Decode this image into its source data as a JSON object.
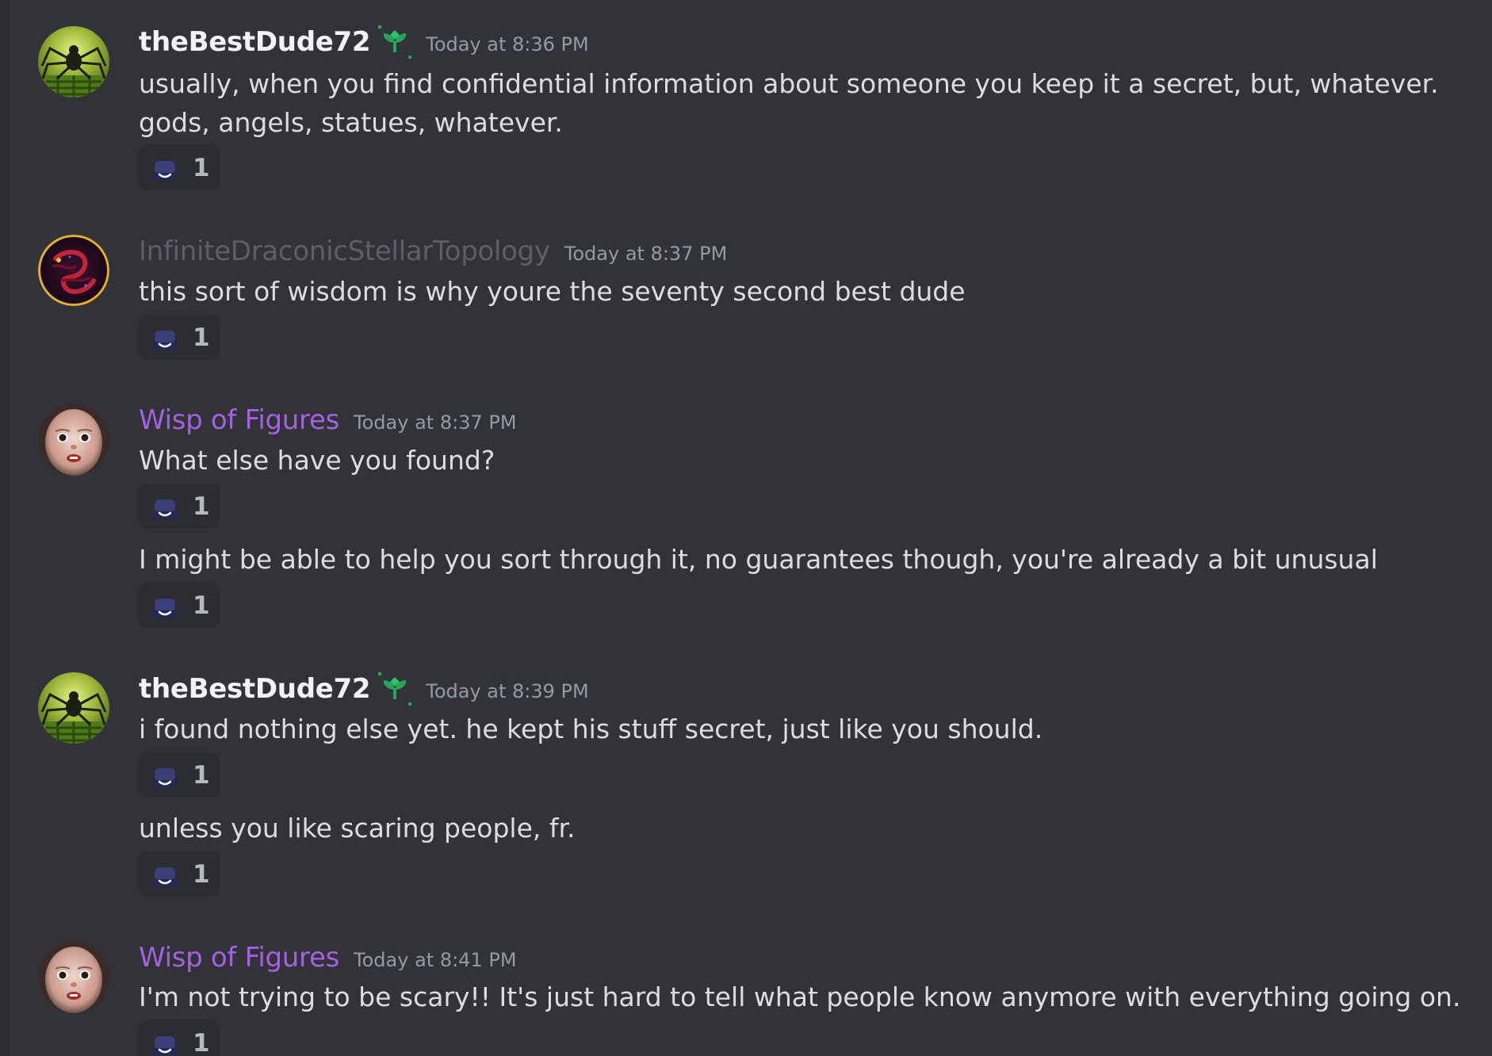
{
  "colors": {
    "background": "#313338",
    "username_default": "#f2f3f5",
    "username_violet": "#a561e0",
    "username_faded": "#5c5f66",
    "timestamp": "#949ba4",
    "message_text": "#dbdee1",
    "reaction_bg": "#2b2d31",
    "badge_green": "#23a55a"
  },
  "messages": [
    {
      "author": "theBestDude72",
      "badge_icon": "sprout-badge-icon",
      "avatar_icon": "spider-maze-avatar",
      "timestamp": "Today at 8:36 PM",
      "lines": [
        "usually, when you find confidential information about someone you keep it a secret, but, whatever.",
        "gods, angels, statues, whatever."
      ],
      "reaction": {
        "emoji_icon": "smiling-hat-emoji-icon",
        "count": "1"
      }
    },
    {
      "author": "InfiniteDraconicStellarTopology",
      "avatar_icon": "red-dragon-avatar",
      "timestamp": "Today at 8:37 PM",
      "lines": [
        "this sort of wisdom is why youre the seventy second best dude"
      ],
      "reaction": {
        "emoji_icon": "smiling-hat-emoji-icon",
        "count": "1"
      }
    },
    {
      "author": "Wisp of Figures",
      "avatar_icon": "doll-face-avatar",
      "timestamp": "Today at 8:37 PM",
      "lines": [
        "What else have you found?"
      ],
      "reaction": {
        "emoji_icon": "smiling-hat-emoji-icon",
        "count": "1"
      },
      "followups": [
        {
          "text": "I might be able to help you sort through it, no guarantees though, you're already a bit unusual",
          "reaction": {
            "emoji_icon": "smiling-hat-emoji-icon",
            "count": "1"
          }
        }
      ]
    },
    {
      "author": "theBestDude72",
      "badge_icon": "sprout-badge-icon",
      "avatar_icon": "spider-maze-avatar",
      "timestamp": "Today at 8:39 PM",
      "lines": [
        "i found nothing else yet. he kept his stuff secret, just like you should."
      ],
      "reaction": {
        "emoji_icon": "smiling-hat-emoji-icon",
        "count": "1"
      },
      "followups": [
        {
          "text": "unless you like scaring people, fr.",
          "reaction": {
            "emoji_icon": "smiling-hat-emoji-icon",
            "count": "1"
          }
        }
      ]
    },
    {
      "author": "Wisp of Figures",
      "avatar_icon": "doll-face-avatar",
      "timestamp": "Today at 8:41 PM",
      "lines": [
        "I'm not trying to be scary!! It's just hard to tell what people know anymore with everything going on."
      ],
      "reaction": {
        "emoji_icon": "smiling-hat-emoji-icon",
        "count": "1"
      }
    }
  ]
}
